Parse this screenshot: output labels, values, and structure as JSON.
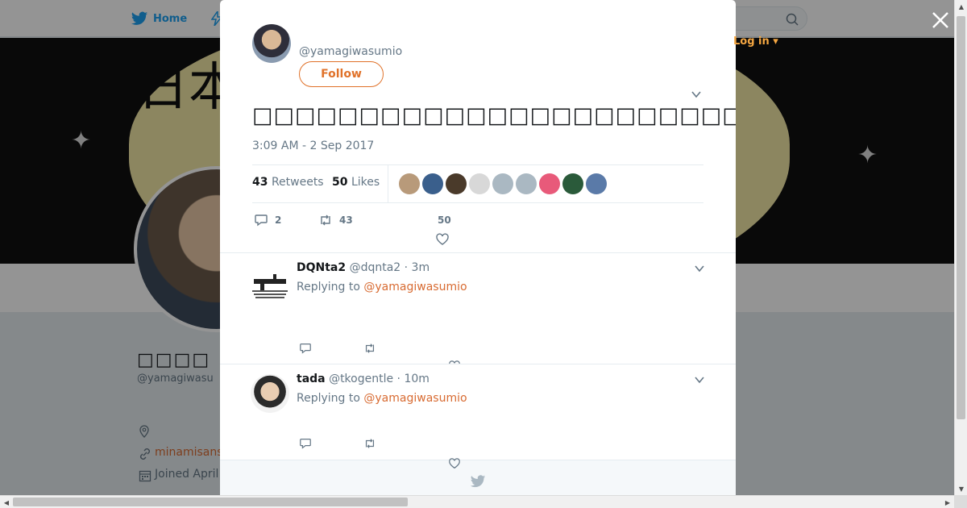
{
  "nav": {
    "home_label": "Home",
    "login_label": "Log in ▾"
  },
  "profile": {
    "banner_kanji": "日本",
    "name": "□□□□",
    "handle": "@yamagiwasu",
    "link": "minamisans",
    "joined": "Joined April"
  },
  "tweet": {
    "handle": "@yamagiwasumio",
    "follow_label": "Follow",
    "text": "□□□□□□□□□□□□□□□□□□□□□□□□□□□□□□□□□□□□□□□□□□□□□□□□",
    "timestamp": "3:09 AM - 2 Sep 2017",
    "retweets_count": "43",
    "retweets_label": "Retweets",
    "likes_count": "50",
    "likes_label": "Likes",
    "reply_count": "2",
    "retweet_action_count": "43",
    "like_action_count": "50",
    "liker_colors": [
      "#b89a7a",
      "#3a5f8c",
      "#4a3a2a",
      "#d8d8d8",
      "#aab8c2",
      "#aab8c2",
      "#e85a7a",
      "#2a5a3a",
      "#5a7aa8"
    ]
  },
  "replies": [
    {
      "name": "DQNta2",
      "handle": "@dqnta2",
      "time": "· 3m",
      "replying_prefix": "Replying to",
      "replying_to": "@yamagiwasumio"
    },
    {
      "name": "tada",
      "handle": "@tkogentle",
      "time": "· 10m",
      "replying_prefix": "Replying to",
      "replying_to": "@yamagiwasumio"
    }
  ],
  "colors": {
    "accent": "#e0722a",
    "link": "#d86b32",
    "muted": "#657786",
    "twitter_blue": "#1da1f2"
  }
}
